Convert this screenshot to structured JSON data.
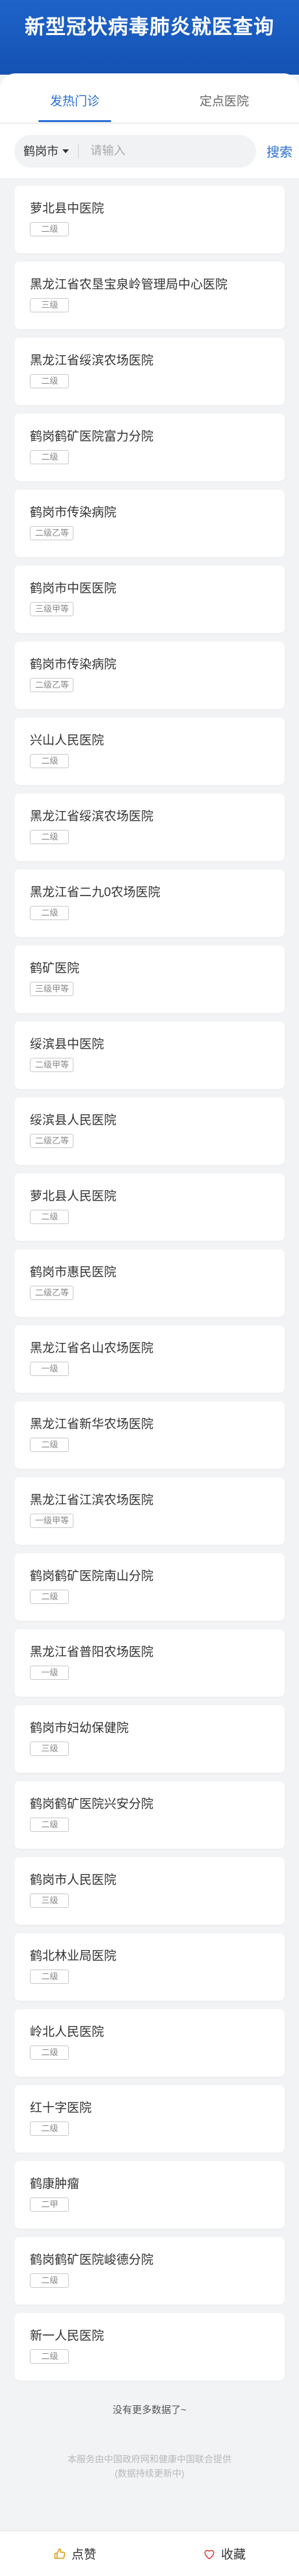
{
  "header": {
    "title": "新型冠状病毒肺炎就医查询"
  },
  "tabs": [
    {
      "label": "发热门诊",
      "active": true
    },
    {
      "label": "定点医院",
      "active": false
    }
  ],
  "search": {
    "city": "鹤岗市",
    "placeholder": "请输入",
    "value": "",
    "button_label": "搜索"
  },
  "hospitals": [
    {
      "name": "萝北县中医院",
      "level": "二级"
    },
    {
      "name": "黑龙江省农垦宝泉岭管理局中心医院",
      "level": "三级"
    },
    {
      "name": "黑龙江省绥滨农场医院",
      "level": "二级"
    },
    {
      "name": "鹤岗鹤矿医院富力分院",
      "level": "二级"
    },
    {
      "name": "鹤岗市传染病院",
      "level": "二级乙等"
    },
    {
      "name": "鹤岗市中医医院",
      "level": "三级甲等"
    },
    {
      "name": "鹤岗市传染病院",
      "level": "二级乙等"
    },
    {
      "name": "兴山人民医院",
      "level": "二级"
    },
    {
      "name": "黑龙江省绥滨农场医院",
      "level": "二级"
    },
    {
      "name": "黑龙江省二九0农场医院",
      "level": "二级"
    },
    {
      "name": "鹤矿医院",
      "level": "三级甲等"
    },
    {
      "name": "绥滨县中医院",
      "level": "二级甲等"
    },
    {
      "name": "绥滨县人民医院",
      "level": "二级乙等"
    },
    {
      "name": "萝北县人民医院",
      "level": "二级"
    },
    {
      "name": "鹤岗市惠民医院",
      "level": "二级乙等"
    },
    {
      "name": "黑龙江省名山农场医院",
      "level": "一级"
    },
    {
      "name": "黑龙江省新华农场医院",
      "level": "二级"
    },
    {
      "name": "黑龙江省江滨农场医院",
      "level": "一级甲等"
    },
    {
      "name": "鹤岗鹤矿医院南山分院",
      "level": "二级"
    },
    {
      "name": "黑龙江省普阳农场医院",
      "level": "一级"
    },
    {
      "name": "鹤岗市妇幼保健院",
      "level": "三级"
    },
    {
      "name": "鹤岗鹤矿医院兴安分院",
      "level": "二级"
    },
    {
      "name": "鹤岗市人民医院",
      "level": "三级"
    },
    {
      "name": "鹤北林业局医院",
      "level": "二级"
    },
    {
      "name": "岭北人民医院",
      "level": "二级"
    },
    {
      "name": "红十字医院",
      "level": "二级"
    },
    {
      "name": "鹤康肿瘤",
      "level": "二甲"
    },
    {
      "name": "鹤岗鹤矿医院峻德分院",
      "level": "二级"
    },
    {
      "name": "新一人民医院",
      "level": "二级"
    }
  ],
  "list_end_text": "没有更多数据了~",
  "footer_note": {
    "line1": "本服务由中国政府网和健康中国联合提供",
    "line2": "(数据持续更新中)"
  },
  "bottom_bar": {
    "like_label": "点赞",
    "like_icon": "thumbs-up-icon",
    "favorite_label": "收藏",
    "favorite_icon": "heart-icon"
  },
  "colors": {
    "header_bg": "#1552b3",
    "accent": "#2a6fd6",
    "favorite_icon": "#e04a4a"
  }
}
